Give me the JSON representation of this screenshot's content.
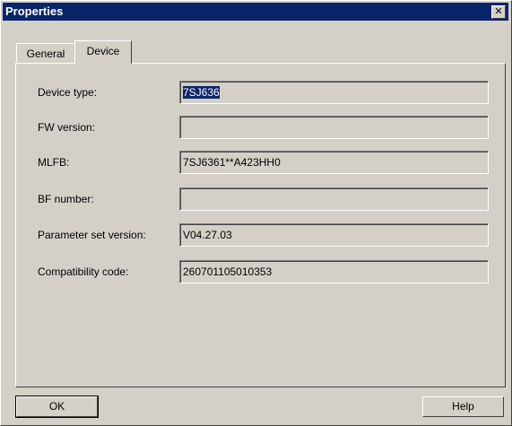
{
  "window": {
    "title": "Properties",
    "close_symbol": "✕"
  },
  "tabs": [
    {
      "label": "General",
      "active": false
    },
    {
      "label": "Device",
      "active": true
    }
  ],
  "device": {
    "fields": [
      {
        "label": "Device type:",
        "value": "7SJ636",
        "selected": true
      },
      {
        "label": "FW version:",
        "value": ""
      },
      {
        "label": "MLFB:",
        "value": "7SJ6361**A423HH0"
      },
      {
        "label": "BF number:",
        "value": ""
      },
      {
        "label": "Parameter set version:",
        "value": "V04.27.03"
      },
      {
        "label": "Compatibility code:",
        "value": "260701105010353"
      }
    ]
  },
  "buttons": {
    "ok_label": "OK",
    "help_label": "Help"
  },
  "colors": {
    "titlebar": "#0a246a",
    "face": "#d4d0c8",
    "selection": "#0a246a"
  }
}
